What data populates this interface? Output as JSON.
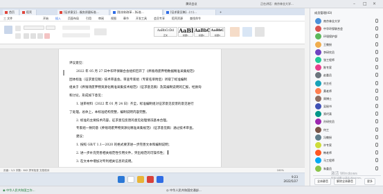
{
  "meeting": {
    "title": "腾讯会议",
    "info": "正在讲话：南京林业大学...",
    "speaker": "◉ 中华人民共和国工作...",
    "bottom_right": "◎ 中华人民共和国交通部..."
  },
  "browser": {
    "tabs": [
      {
        "label": "首页",
        "color": "#e0463b"
      },
      {
        "label": "稻壳",
        "color": "#e0463b"
      },
      {
        "label": "[征求意见]...服务质量标准...",
        "color": "#e0463b"
      },
      {
        "label": "[股份制改革...]标准...",
        "color": "#2f6ce5"
      },
      {
        "label": "[征求意见稿]...(二)...",
        "color": "#2f6ce5"
      }
    ]
  },
  "menubar": {
    "items": [
      "三 文件",
      "开始",
      "插入",
      "页面布局",
      "引用",
      "审阅",
      "视图",
      "章节",
      "开发工具",
      "会员专享",
      "稻壳资源",
      "查找命令"
    ]
  },
  "ribbon": {
    "styles": [
      {
        "sample": "AaBbCcDd",
        "name": "正文"
      },
      {
        "sample": "AaBl",
        "name": "标题1"
      },
      {
        "sample": "AaBbC",
        "name": "标题2"
      },
      {
        "sample": "AaBbC",
        "name": "标题3"
      }
    ]
  },
  "document": {
    "lines": [
      "评议意见：",
      "2022 年 05 月 27 日中华环保联合会组织召开了《养殖场废弃物数据精准采集规范》",
      "团体标准（征求意见稿）技术审查会。审查专家组（专家名单附后）听取了标准编制",
      "组关于《养殖场废弃物资源化精准采集技术规范》（征求意见稿）及其编制说明的汇报，经质询",
      "和讨论，形成如下意见：",
      "1. 送审材料（2022 年 01 月 24 日）齐全，标准编制组对征求意见反馈的意见进行",
      "了处理。总体上，本标准结构完整，编制说明内容完整。",
      "2. 标准的主要技术内容，征求意见反馈的意见处理情况基本合理。",
      "专家组一致同意《养殖场废弃物资源化精准采集规范》（征求意见稿）通过技术审查。",
      "建议：",
      "1. 按照 GB/T 1.1—2020 的格式要求进一步完善文本和编制说明；",
      "2. 进一步补充完善相关规范性引用文件，突出规范的可操作性；",
      "3. 在文本中增加对专利相关信息的说明。"
    ]
  },
  "statusbar": {
    "left": "页面：1/1   字数：642   拼写检查   文档校对",
    "right": "100%"
  },
  "taskbar": {
    "time": "9:23",
    "date": "2022/5/27"
  },
  "panel": {
    "title": "成员管理(43)",
    "participants": [
      {
        "name": "南京林业大学",
        "color": "#4a90d9"
      },
      {
        "name": "中华环保联合会",
        "color": "#d9534f"
      },
      {
        "name": "环境保护部",
        "color": "#5cb85c"
      },
      {
        "name": "王教授",
        "color": "#f0ad4e"
      },
      {
        "name": "李研究员",
        "color": "#6f42c1"
      },
      {
        "name": "张工程师",
        "color": "#20c997"
      },
      {
        "name": "陈专家",
        "color": "#e83e8c"
      },
      {
        "name": "赵委员",
        "color": "#6c757d"
      },
      {
        "name": "刘主任",
        "color": "#17a2b8"
      },
      {
        "name": "黄老师",
        "color": "#ff7f50"
      },
      {
        "name": "周博士",
        "color": "#8d6e63"
      },
      {
        "name": "吴秘书",
        "color": "#3f51b5"
      },
      {
        "name": "郑代表",
        "color": "#009688"
      },
      {
        "name": "孙研究员",
        "color": "#9c27b0"
      },
      {
        "name": "何工",
        "color": "#795548"
      },
      {
        "name": "冯教授",
        "color": "#607d8b"
      },
      {
        "name": "许专家",
        "color": "#cddc39"
      },
      {
        "name": "韩老师",
        "color": "#ff5722"
      },
      {
        "name": "马工程师",
        "color": "#03a9f4"
      },
      {
        "name": "朱委员",
        "color": "#8bc34a"
      }
    ],
    "buttons": [
      "全体静音",
      "解除全体静音",
      "更多"
    ]
  },
  "watermark": {
    "title": "激活 Windows",
    "sub": "转到\"设置\"以激活 Windows。"
  }
}
